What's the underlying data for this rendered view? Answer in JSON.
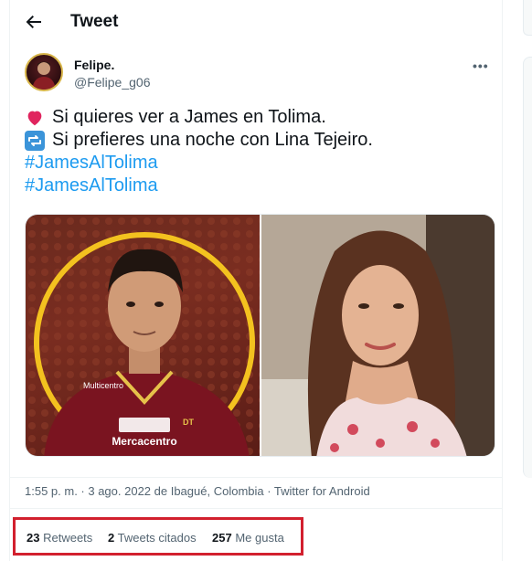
{
  "header": {
    "title": "Tweet"
  },
  "author": {
    "name": "Felipe.",
    "handle": "@Felipe_g06"
  },
  "tweet": {
    "line1": "Si quieres ver a James en Tolima.",
    "line2": "Si prefieres una noche con Lina Tejeiro.",
    "hashtag1": "#JamesAlTolima",
    "hashtag2": "#JamesAlTolima"
  },
  "media": {
    "left_label": "Mercacentro",
    "left_sponsor_top": "Multicentro",
    "left_badge": "DT"
  },
  "meta": {
    "timestamp": "1:55 p. m. · 3 ago. 2022 de Ibagué, Colombia · Twitter for Android"
  },
  "stats": {
    "retweets_count": "23",
    "retweets_label": "Retweets",
    "quotes_count": "2",
    "quotes_label": "Tweets citados",
    "likes_count": "257",
    "likes_label": "Me gusta"
  },
  "colors": {
    "accent": "#1d9bf0",
    "highlight_box": "#d2202e",
    "heart": "#e0245e"
  },
  "icons": {
    "back": "arrow-left-icon",
    "more": "more-horizontal-icon",
    "heart_emoji": "heart-emoji-icon",
    "repeat_emoji": "repeat-emoji-icon"
  }
}
